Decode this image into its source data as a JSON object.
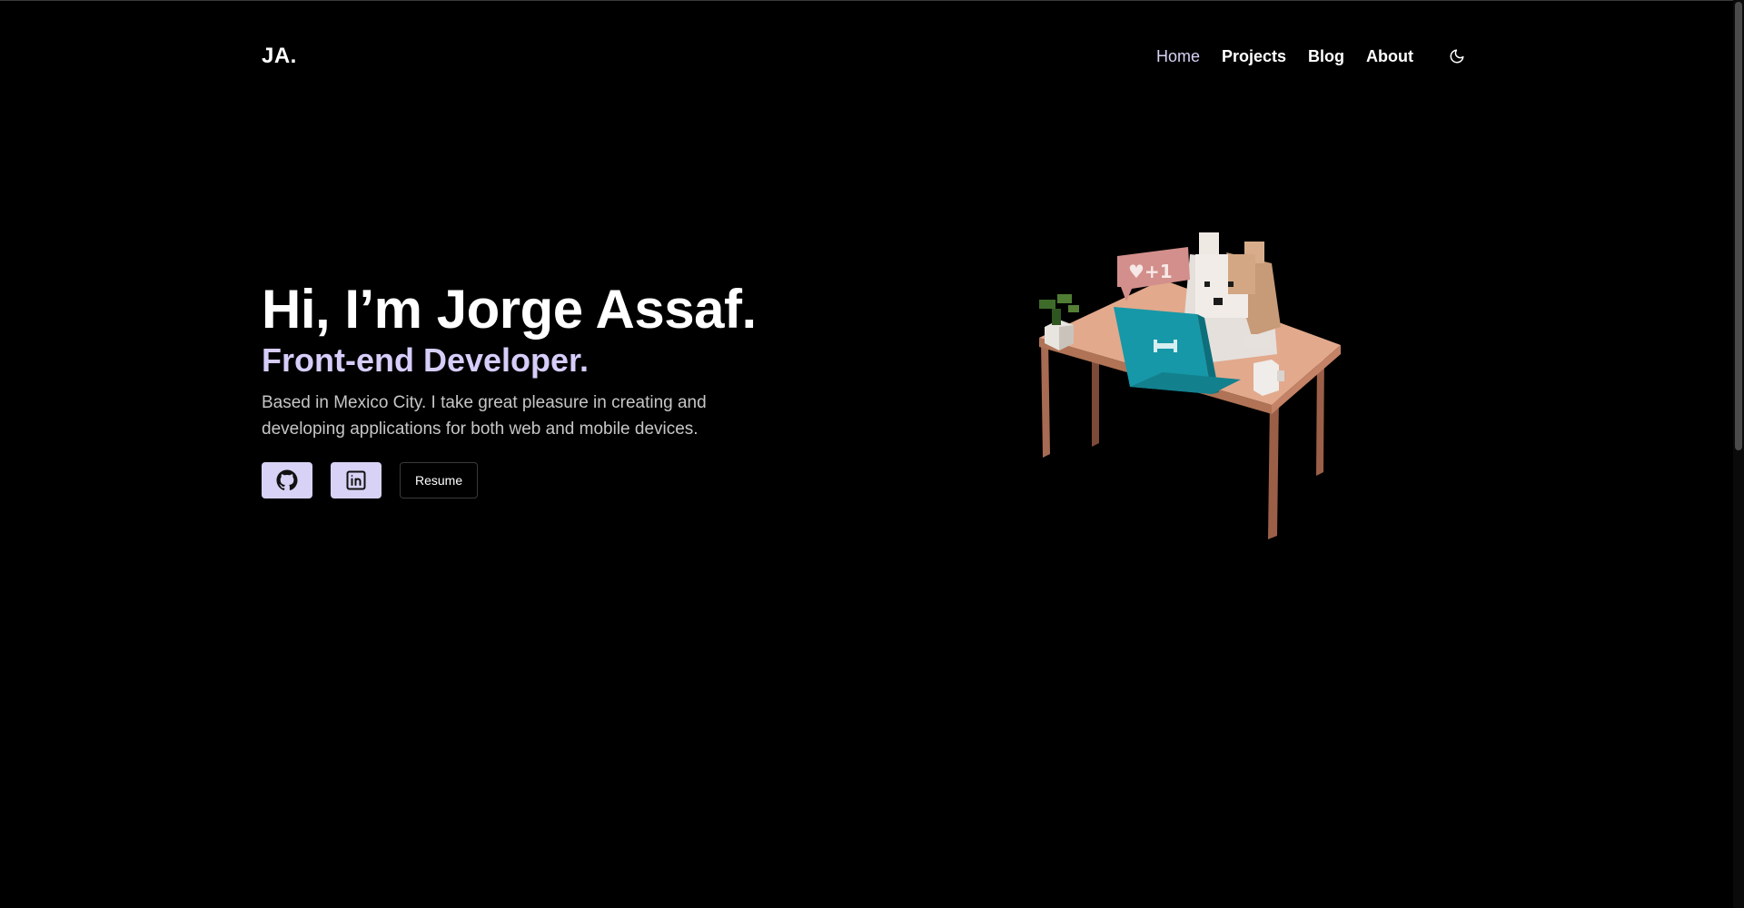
{
  "header": {
    "logo": "JA.",
    "nav": [
      {
        "label": "Home",
        "active": true
      },
      {
        "label": "Projects",
        "active": false
      },
      {
        "label": "Blog",
        "active": false
      },
      {
        "label": "About",
        "active": false
      }
    ],
    "theme_toggle_icon": "moon-icon"
  },
  "hero": {
    "title": "Hi, I’m Jorge Assaf.",
    "subtitle": "Front-end Developer.",
    "description": "Based in Mexico City. I take great pleasure in creating and developing applications for both web and mobile devices.",
    "buttons": {
      "github_icon": "github-icon",
      "linkedin_icon": "linkedin-icon",
      "resume_label": "Resume"
    }
  },
  "illustration": {
    "bubble_text": "♥+1"
  },
  "colors": {
    "background": "#000000",
    "accent": "#d8d2f6",
    "subtitle": "#d6cdfa",
    "text_muted": "#c6c6c6"
  }
}
